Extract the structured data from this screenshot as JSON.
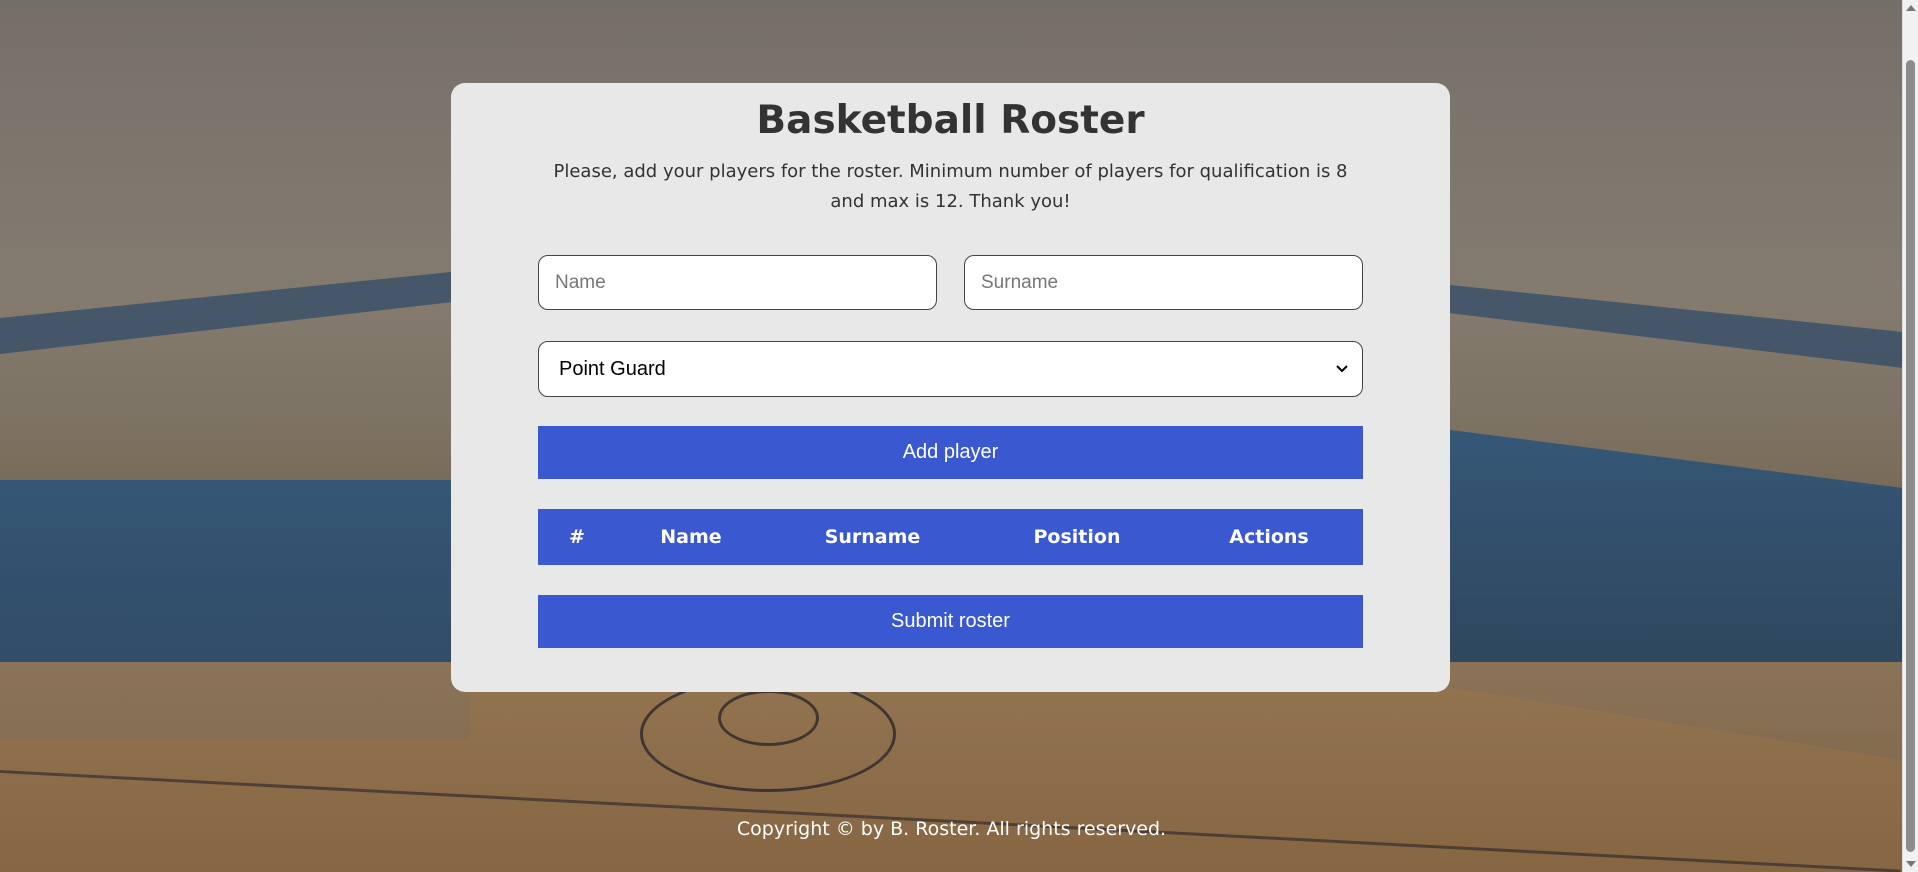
{
  "form": {
    "title": "Basketball Roster",
    "subtitle": "Please, add your players for the roster. Minimum number of players for qualification is 8 and max is 12. Thank you!",
    "name_placeholder": "Name",
    "surname_placeholder": "Surname",
    "position_selected": "Point Guard",
    "add_button_label": "Add player",
    "submit_button_label": "Submit roster"
  },
  "table": {
    "columns": [
      "#",
      "Name",
      "Surname",
      "Position",
      "Actions"
    ],
    "rows": []
  },
  "footer": {
    "text": "Copyright © by B. Roster. All rights reserved."
  },
  "colors": {
    "accent": "#3a59d1",
    "card_background": "#e8e8e8",
    "text": "#333333"
  }
}
